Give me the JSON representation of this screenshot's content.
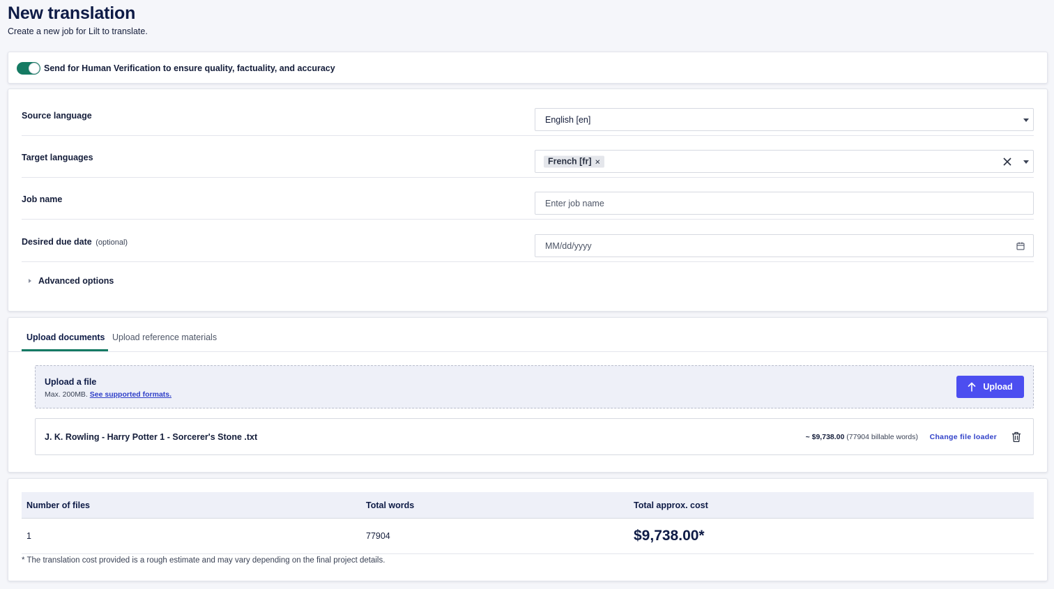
{
  "header": {
    "title": "New translation",
    "subtitle": "Create a new job for Lilt to translate."
  },
  "verification": {
    "label": "Send for Human Verification to ensure quality, factuality, and accuracy",
    "enabled": true,
    "accent_color": "#157a63"
  },
  "form": {
    "source_language": {
      "label": "Source language",
      "value": "English [en]"
    },
    "target_languages": {
      "label": "Target languages",
      "chips": [
        "French [fr]"
      ],
      "chip_remove": "×"
    },
    "job_name": {
      "label": "Job name",
      "placeholder": "Enter job name"
    },
    "due_date": {
      "label": "Desired due date",
      "optional": "(optional)",
      "placeholder": "MM/dd/yyyy"
    },
    "advanced_options": "Advanced options"
  },
  "upload": {
    "tabs": [
      "Upload documents",
      "Upload reference materials"
    ],
    "active_tab": 0,
    "dropzone": {
      "title": "Upload a file",
      "max_size": "Max. 200MB.",
      "formats_link": "See supported formats."
    },
    "upload_button": "Upload",
    "button_color": "#4c4ef0",
    "files": [
      {
        "name": "J. K. Rowling - Harry Potter 1 - Sorcerer's Stone .txt",
        "cost": "~ $9,738.00",
        "words": "(77904 billable words)",
        "change_loader": "Change file loader"
      }
    ]
  },
  "summary": {
    "headers": [
      "Number of files",
      "Total words",
      "Total approx. cost"
    ],
    "values": [
      "1",
      "77904",
      "$9,738.00*"
    ],
    "footnote": "* The translation cost provided is a rough estimate and may vary depending on the final project details."
  }
}
